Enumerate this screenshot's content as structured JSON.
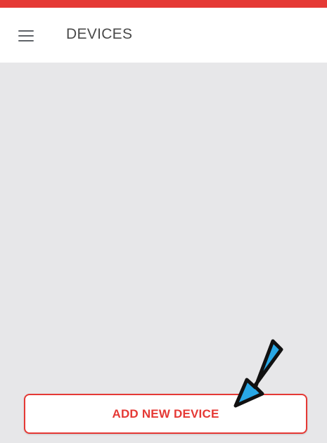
{
  "header": {
    "title": "DEVICES",
    "menu_icon": "hamburger-menu-icon"
  },
  "main": {
    "add_button_label": "ADD NEW DEVICE"
  },
  "annotation": {
    "arrow_icon": "pointer-arrow-icon",
    "arrow_color": "#29a8e6"
  },
  "colors": {
    "accent": "#e53935",
    "background": "#e7e7e9"
  }
}
